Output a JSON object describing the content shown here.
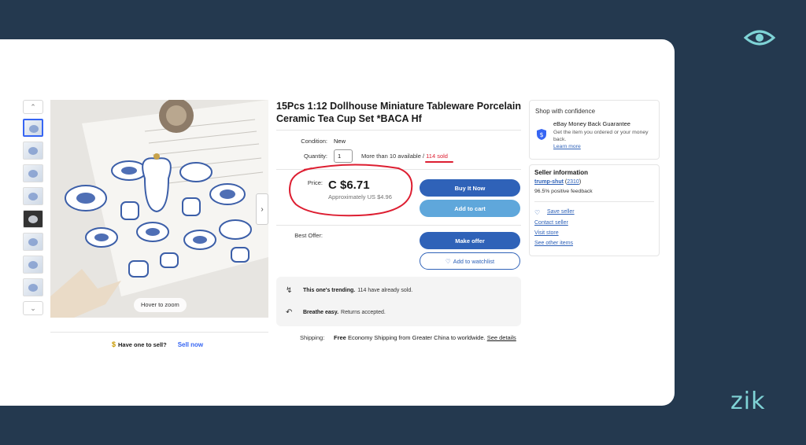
{
  "title": "15Pcs 1:12 Dollhouse Miniature Tableware Porcelain Ceramic Tea Cup Set *BACA Hf",
  "condition": {
    "label": "Condition:",
    "value": "New"
  },
  "quantity": {
    "label": "Quantity:",
    "value": "1",
    "available": "More than 10 available",
    "separator": " / ",
    "sold": "114 sold"
  },
  "price": {
    "label": "Price:",
    "value": "C $6.71",
    "approx": "Approximately US $4.96"
  },
  "buttons": {
    "buy_now": "Buy It Now",
    "add_to_cart": "Add to cart",
    "make_offer": "Make offer",
    "watchlist": "Add to watchlist"
  },
  "best_offer_label": "Best Offer:",
  "trend": {
    "line1_bold": "This one's trending.",
    "line1_rest": "114 have already sold.",
    "line2_bold": "Breathe easy.",
    "line2_rest": "Returns accepted."
  },
  "shipping": {
    "label": "Shipping:",
    "bold": "Free",
    "text": "Economy Shipping from Greater China to worldwide.",
    "link": "See details"
  },
  "image": {
    "hover_zoom": "Hover to zoom"
  },
  "sell": {
    "prompt": "Have one to sell?",
    "link": "Sell now"
  },
  "confidence": {
    "title": "Shop with confidence",
    "heading": "eBay Money Back Guarantee",
    "body": "Get the item you ordered or your money back.",
    "link": "Learn more"
  },
  "seller": {
    "title": "Seller information",
    "name": "trump-shut",
    "score": "2310",
    "feedback": "96.5% positive feedback",
    "links": [
      "Save seller",
      "Contact seller",
      "Visit store",
      "See other items"
    ]
  },
  "brand": {
    "wordmark": "zik"
  },
  "colors": {
    "backdrop": "#24394f",
    "accent_blue": "#2f62b8",
    "light_blue": "#5fa7db",
    "sold_red": "#dd1e31",
    "brand_teal": "#7fd3d6"
  }
}
